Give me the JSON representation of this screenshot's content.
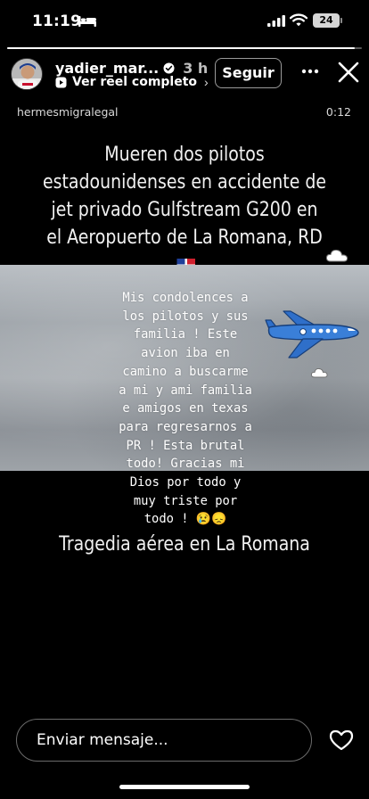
{
  "status_bar": {
    "time": "11:19",
    "battery": "24",
    "icons": [
      "bed-icon",
      "signal-icon",
      "wifi-icon",
      "battery-icon"
    ]
  },
  "story": {
    "progress": 0.98,
    "username": "yadier_mar...",
    "time_ago": "3 h",
    "reel_link": "Ver reel completo",
    "follow_label": "Seguir",
    "reel_handle": "hermesmigralegal",
    "reel_time": "0:12",
    "headline": "Mueren dos pilotos estadounidenses en accidente de jet privado Gulfstream G200 en el Aeropuerto de La Romana, RD",
    "caption": "Mis condolences a\nlos pilotos y sus\nfamilia ! Este\navion iba en\ncamino a buscarme\na mi y ami familia\ne amigos en texas\npara regresarnos a\nPR !  Esta brutal\ntodo! Gracias mi\nDios por todo y\nmuy triste por\ntodo ! 😢😞",
    "tagline": "Tragedia aérea en La Romana"
  },
  "footer": {
    "message_placeholder": "Enviar mensaje..."
  },
  "colors": {
    "background": "#000000",
    "plane": "#2f6fc9",
    "flag_blue": "#1f3f99",
    "flag_red": "#d0202e"
  }
}
